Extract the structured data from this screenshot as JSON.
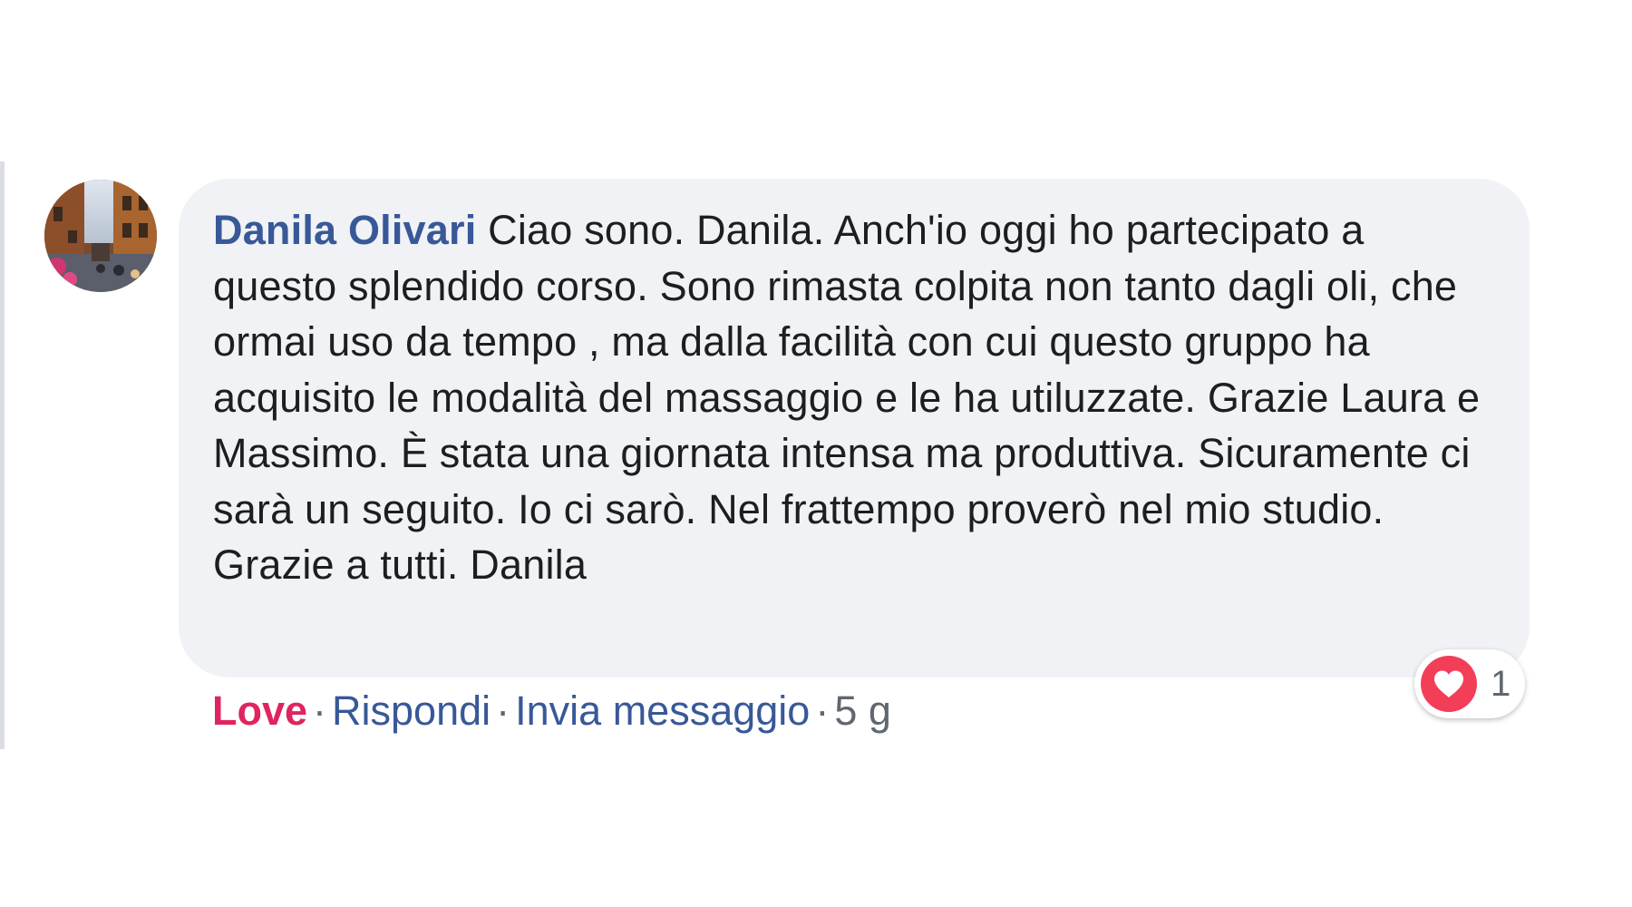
{
  "comment": {
    "author": "Danila Olivari",
    "text": "Ciao sono. Danila. Anch'io oggi ho partecipato a questo splendido corso. Sono rimasta colpita non tanto dagli oli, che ormai uso da tempo , ma dalla facilità con cui questo gruppo ha acquisito le modalità del massaggio e le ha utiluzzate. Grazie Laura e Massimo. È stata una giornata intensa ma produttiva. Sicuramente ci sarà un seguito. Io ci sarò. Nel frattempo proverò nel mio studio. Grazie a tutti. Danila"
  },
  "actions": {
    "love_label": "Love",
    "reply_label": "Rispondi",
    "message_label": "Invia messaggio",
    "separator": "·",
    "timestamp": "5 g"
  },
  "reactions": {
    "icon": "heart-icon",
    "count": "1"
  },
  "colors": {
    "link": "#385898",
    "love": "#e0245e",
    "bubble_bg": "#f0f2f5",
    "text": "#1c1e21",
    "muted": "#606770"
  }
}
